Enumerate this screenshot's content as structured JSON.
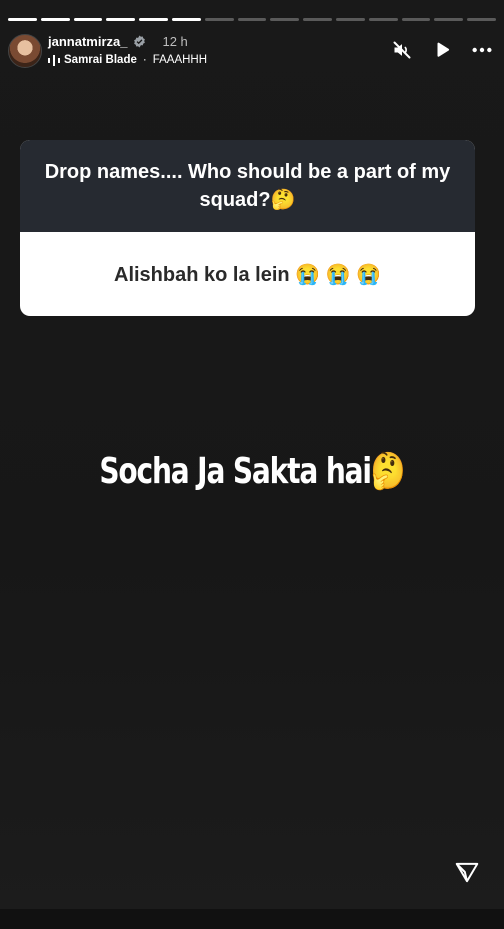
{
  "progress": {
    "segments": [
      1,
      1,
      1,
      1,
      1,
      1,
      0,
      0,
      0,
      0,
      0,
      0,
      0,
      0,
      0
    ]
  },
  "header": {
    "username": "jannatmirza_",
    "time": "12 h",
    "music_artist": "Samrai Blade",
    "music_title": "FAAAHHH",
    "icons": [
      "muted-speaker-icon",
      "play-icon",
      "more-icon"
    ]
  },
  "question": {
    "prompt": "Drop names.... Who should be a part of my squad?🤔",
    "answer": "Alishbah ko la lein 😭 😭 😭"
  },
  "overlay_text": "Socha Ja Sakta hai🤔",
  "colors": {
    "background": "#171717",
    "question_header": "#262a31",
    "progress_active": "#ffffff",
    "progress_inactive": "#5a5a5a"
  }
}
